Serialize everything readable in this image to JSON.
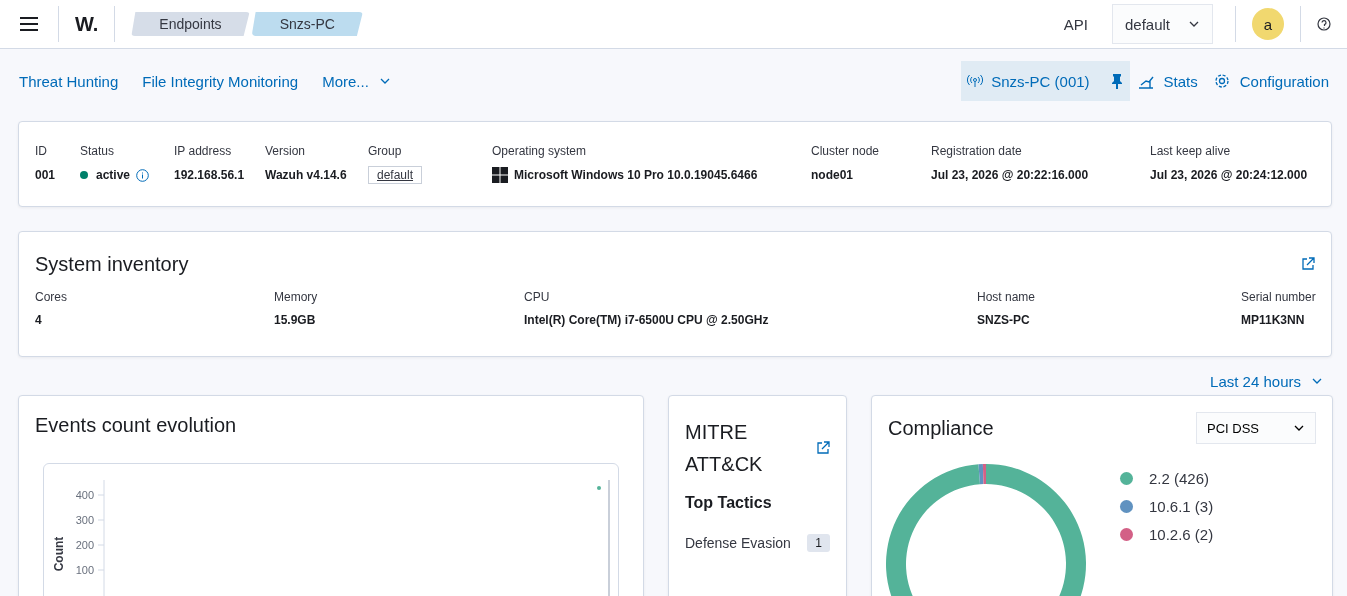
{
  "header": {
    "logo": "W.",
    "breadcrumbs": [
      {
        "label": "Endpoints",
        "selected": false
      },
      {
        "label": "Snzs-PC",
        "selected": true
      }
    ],
    "api_label": "API",
    "api_select": "default",
    "avatar": "a"
  },
  "nav": {
    "links": [
      "Threat Hunting",
      "File Integrity Monitoring"
    ],
    "more": "More...",
    "agent_button": "Snzs-PC (001)",
    "actions": [
      {
        "kind": "stats",
        "label": "Stats"
      },
      {
        "kind": "config",
        "label": "Configuration"
      }
    ]
  },
  "agent": {
    "fields": [
      {
        "kind": "text",
        "label": "ID",
        "value": "001"
      },
      {
        "kind": "status",
        "label": "Status",
        "value": "active",
        "color": "#00806a"
      },
      {
        "kind": "text",
        "label": "IP address",
        "value": "192.168.56.1"
      },
      {
        "kind": "text",
        "label": "Version",
        "value": "Wazuh v4.14.6"
      },
      {
        "kind": "group",
        "label": "Group",
        "value": "default"
      },
      {
        "kind": "os",
        "label": "Operating system",
        "value": "Microsoft Windows 10 Pro 10.0.19045.6466"
      },
      {
        "kind": "text",
        "label": "Cluster node",
        "value": "node01"
      },
      {
        "kind": "text",
        "label": "Registration date",
        "value": "Jul 23, 2026 @ 20:22:16.000"
      },
      {
        "kind": "text",
        "label": "Last keep alive",
        "value": "Jul 23, 2026 @ 20:24:12.000"
      }
    ]
  },
  "inventory": {
    "title": "System inventory",
    "fields": [
      {
        "label": "Cores",
        "value": "4"
      },
      {
        "label": "Memory",
        "value": "15.9GB"
      },
      {
        "label": "CPU",
        "value": "Intel(R) Core(TM) i7-6500U CPU @ 2.50GHz"
      },
      {
        "label": "Host name",
        "value": "SNZS-PC"
      },
      {
        "label": "Serial number",
        "value": "MP11K3NN"
      }
    ]
  },
  "time_range": "Last 24 hours",
  "events": {
    "title": "Events count evolution",
    "axis_title": "Count",
    "y_ticks": [
      "400",
      "300",
      "200",
      "100"
    ]
  },
  "mitre": {
    "title": "MITRE ATT&CK",
    "subtitle": "Top Tactics",
    "tactics": [
      {
        "name": "Defense Evasion",
        "count": "1"
      }
    ]
  },
  "compliance": {
    "title": "Compliance",
    "select": "PCI DSS",
    "legend": [
      {
        "label": "2.2 (426)",
        "color": "#54b399"
      },
      {
        "label": "10.6.1 (3)",
        "color": "#6092c0"
      },
      {
        "label": "10.2.6 (2)",
        "color": "#d36086"
      }
    ]
  }
}
